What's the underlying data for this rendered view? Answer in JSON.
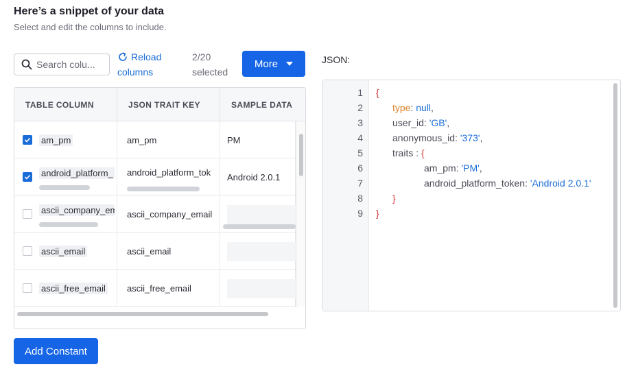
{
  "header": {
    "title": "Here’s a snippet of your data",
    "subtitle": "Select and edit the columns to include."
  },
  "toolbar": {
    "search_placeholder": "Search colu...",
    "reload_line1": "Reload",
    "reload_line2": "columns",
    "selected_count": "2/20",
    "selected_label": "selected",
    "more_label": "More"
  },
  "table": {
    "headers": [
      "TABLE COLUMN",
      "JSON TRAIT KEY",
      "SAMPLE DATA"
    ],
    "rows": [
      {
        "column": "am_pm",
        "trait_key": "am_pm",
        "sample": "PM",
        "checked": true
      },
      {
        "column": "android_platform_",
        "trait_key": "android_platform_tok",
        "sample": "Android 2.0.1",
        "checked": true
      },
      {
        "column": "ascii_company_em",
        "trait_key": "ascii_company_email",
        "sample": "",
        "checked": false
      },
      {
        "column": "ascii_email",
        "trait_key": "ascii_email",
        "sample": "",
        "checked": false
      },
      {
        "column": "ascii_free_email",
        "trait_key": "ascii_free_email",
        "sample": "",
        "checked": false
      }
    ]
  },
  "add_constant_label": "Add Constant",
  "json_panel": {
    "label": "JSON:",
    "line_numbers": [
      "1",
      "2",
      "3",
      "4",
      "5",
      "6",
      "7",
      "8",
      "9"
    ],
    "tokens": {
      "open_brace": "{",
      "type_key": "type",
      "type_colon": ": ",
      "type_val": "null",
      "comma": ",",
      "user_id_key": "user_id: ",
      "user_id_val": "'GB'",
      "anon_key": "anonymous_id: ",
      "anon_val": "'373'",
      "traits_key": "traits : ",
      "am_pm_key": "am_pm: ",
      "am_pm_val": "'PM'",
      "android_key": "android_platform_token: ",
      "android_val": "'Android 2.0.1'",
      "close_brace": "}"
    }
  },
  "colors": {
    "primary": "#1565e6",
    "link": "#1a6cd8",
    "json_key_type": "#d9822b",
    "json_brace": "#d23b3b",
    "json_string": "#1a6cd8"
  }
}
